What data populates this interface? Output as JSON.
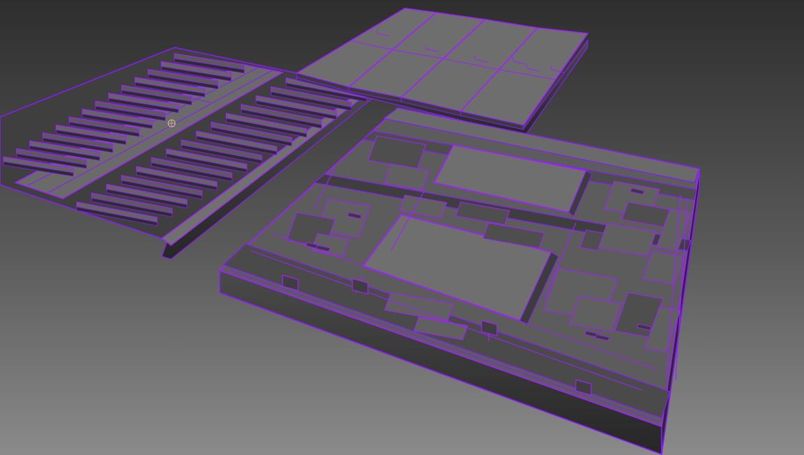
{
  "viewport": {
    "background_top": "#2e2e2e",
    "background_bottom": "#8a8a8a",
    "wire_color": "#8a1aff",
    "wire_bright": "#a020ff",
    "surface_fill": "#6d6d6d",
    "surface_dark": "#3b3b3b",
    "surface_mid": "#565656",
    "edge_dark": "#1f1f1f"
  },
  "objects": [
    {
      "name": "grated-floor-panel",
      "kind": "mesh"
    },
    {
      "name": "plank-floor-panel",
      "kind": "mesh"
    },
    {
      "name": "tech-floor-panel",
      "kind": "mesh"
    }
  ],
  "gizmo": {
    "name": "pivot-gizmo"
  }
}
